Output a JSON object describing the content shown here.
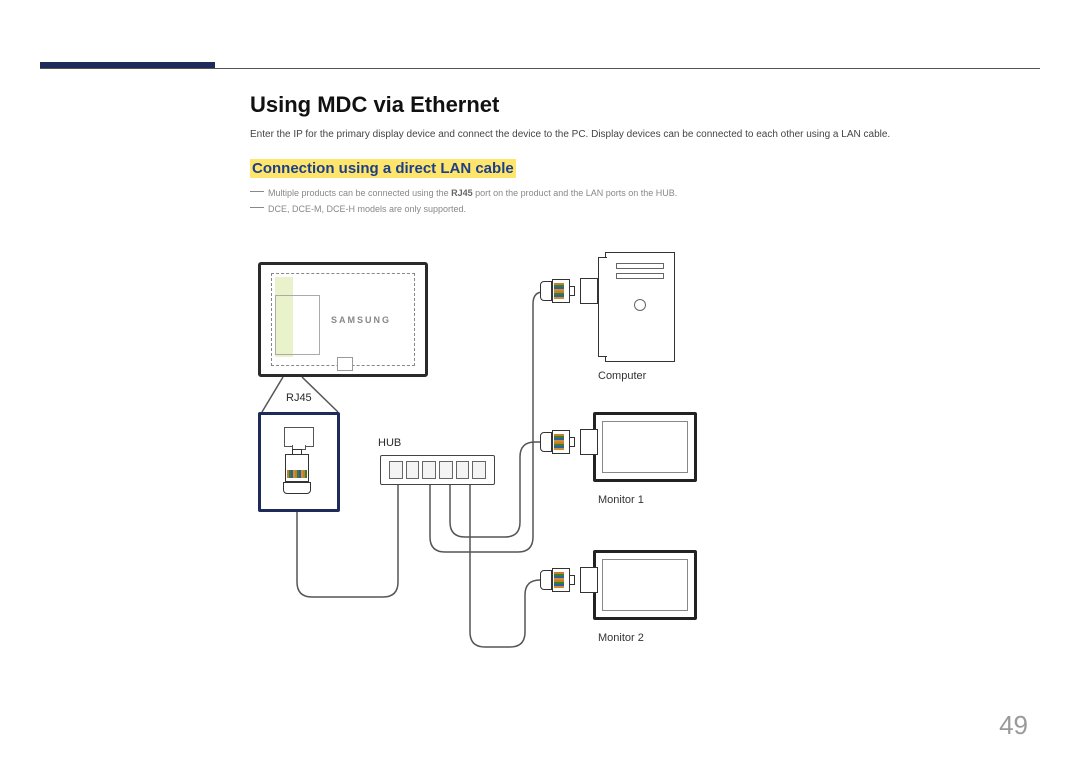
{
  "page": {
    "number": "49",
    "title": "Using MDC via Ethernet",
    "intro": "Enter the IP for the primary display device and connect the device to the PC. Display devices can be connected to each other using a LAN cable.",
    "subheading": "Connection using a direct LAN cable",
    "note1_pre": "Multiple products can be connected using the ",
    "note1_bold": "RJ45",
    "note1_post": " port on the product and the LAN ports on the HUB.",
    "note2": "DCE, DCE-M, DCE-H models are only supported."
  },
  "diagram": {
    "brand": "SAMSUNG",
    "rj45_label": "RJ45",
    "hub_label": "HUB",
    "computer_label": "Computer",
    "monitor1_label": "Monitor 1",
    "monitor2_label": "Monitor 2"
  }
}
